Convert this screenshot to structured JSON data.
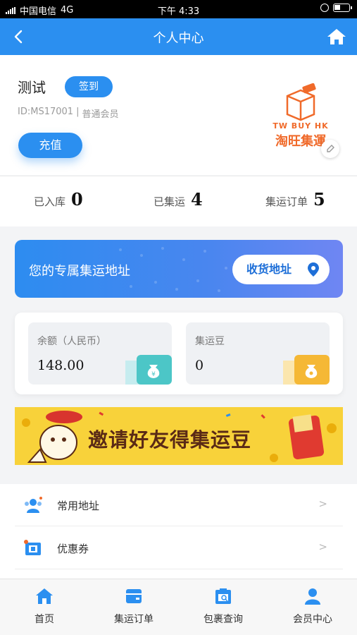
{
  "status": {
    "carrier": "中国电信",
    "network": "4G",
    "time": "下午 4:33"
  },
  "nav": {
    "title": "个人中心"
  },
  "profile": {
    "name": "测试",
    "sign_label": "签到",
    "member_id": "ID:MS17001",
    "separator": "|",
    "member_level": "普通会员",
    "recharge_label": "充值",
    "logo_text_en": "TW BUY HK",
    "logo_text_cn": "淘旺集運"
  },
  "stats": [
    {
      "label": "已入库",
      "value": "0"
    },
    {
      "label": "已集运",
      "value": "4"
    },
    {
      "label": "集运订单",
      "value": "5"
    }
  ],
  "address_banner": {
    "text": "您的专属集运地址",
    "button_label": "收货地址"
  },
  "balance": {
    "rmb_label": "余额（人民币）",
    "rmb_value": "148.00",
    "beans_label": "集运豆",
    "beans_value": "0"
  },
  "invite": {
    "text": "邀请好友得集运豆"
  },
  "list": [
    {
      "label": "常用地址",
      "arrow": ">"
    },
    {
      "label": "优惠券",
      "arrow": ">"
    }
  ],
  "tabs": [
    {
      "label": "首页"
    },
    {
      "label": "集运订单"
    },
    {
      "label": "包裹查询"
    },
    {
      "label": "会员中心"
    }
  ],
  "colors": {
    "primary": "#2b8ff0",
    "teal": "#4cc6c7",
    "gold": "#f5b835",
    "invite_bg": "#f8d23a"
  }
}
